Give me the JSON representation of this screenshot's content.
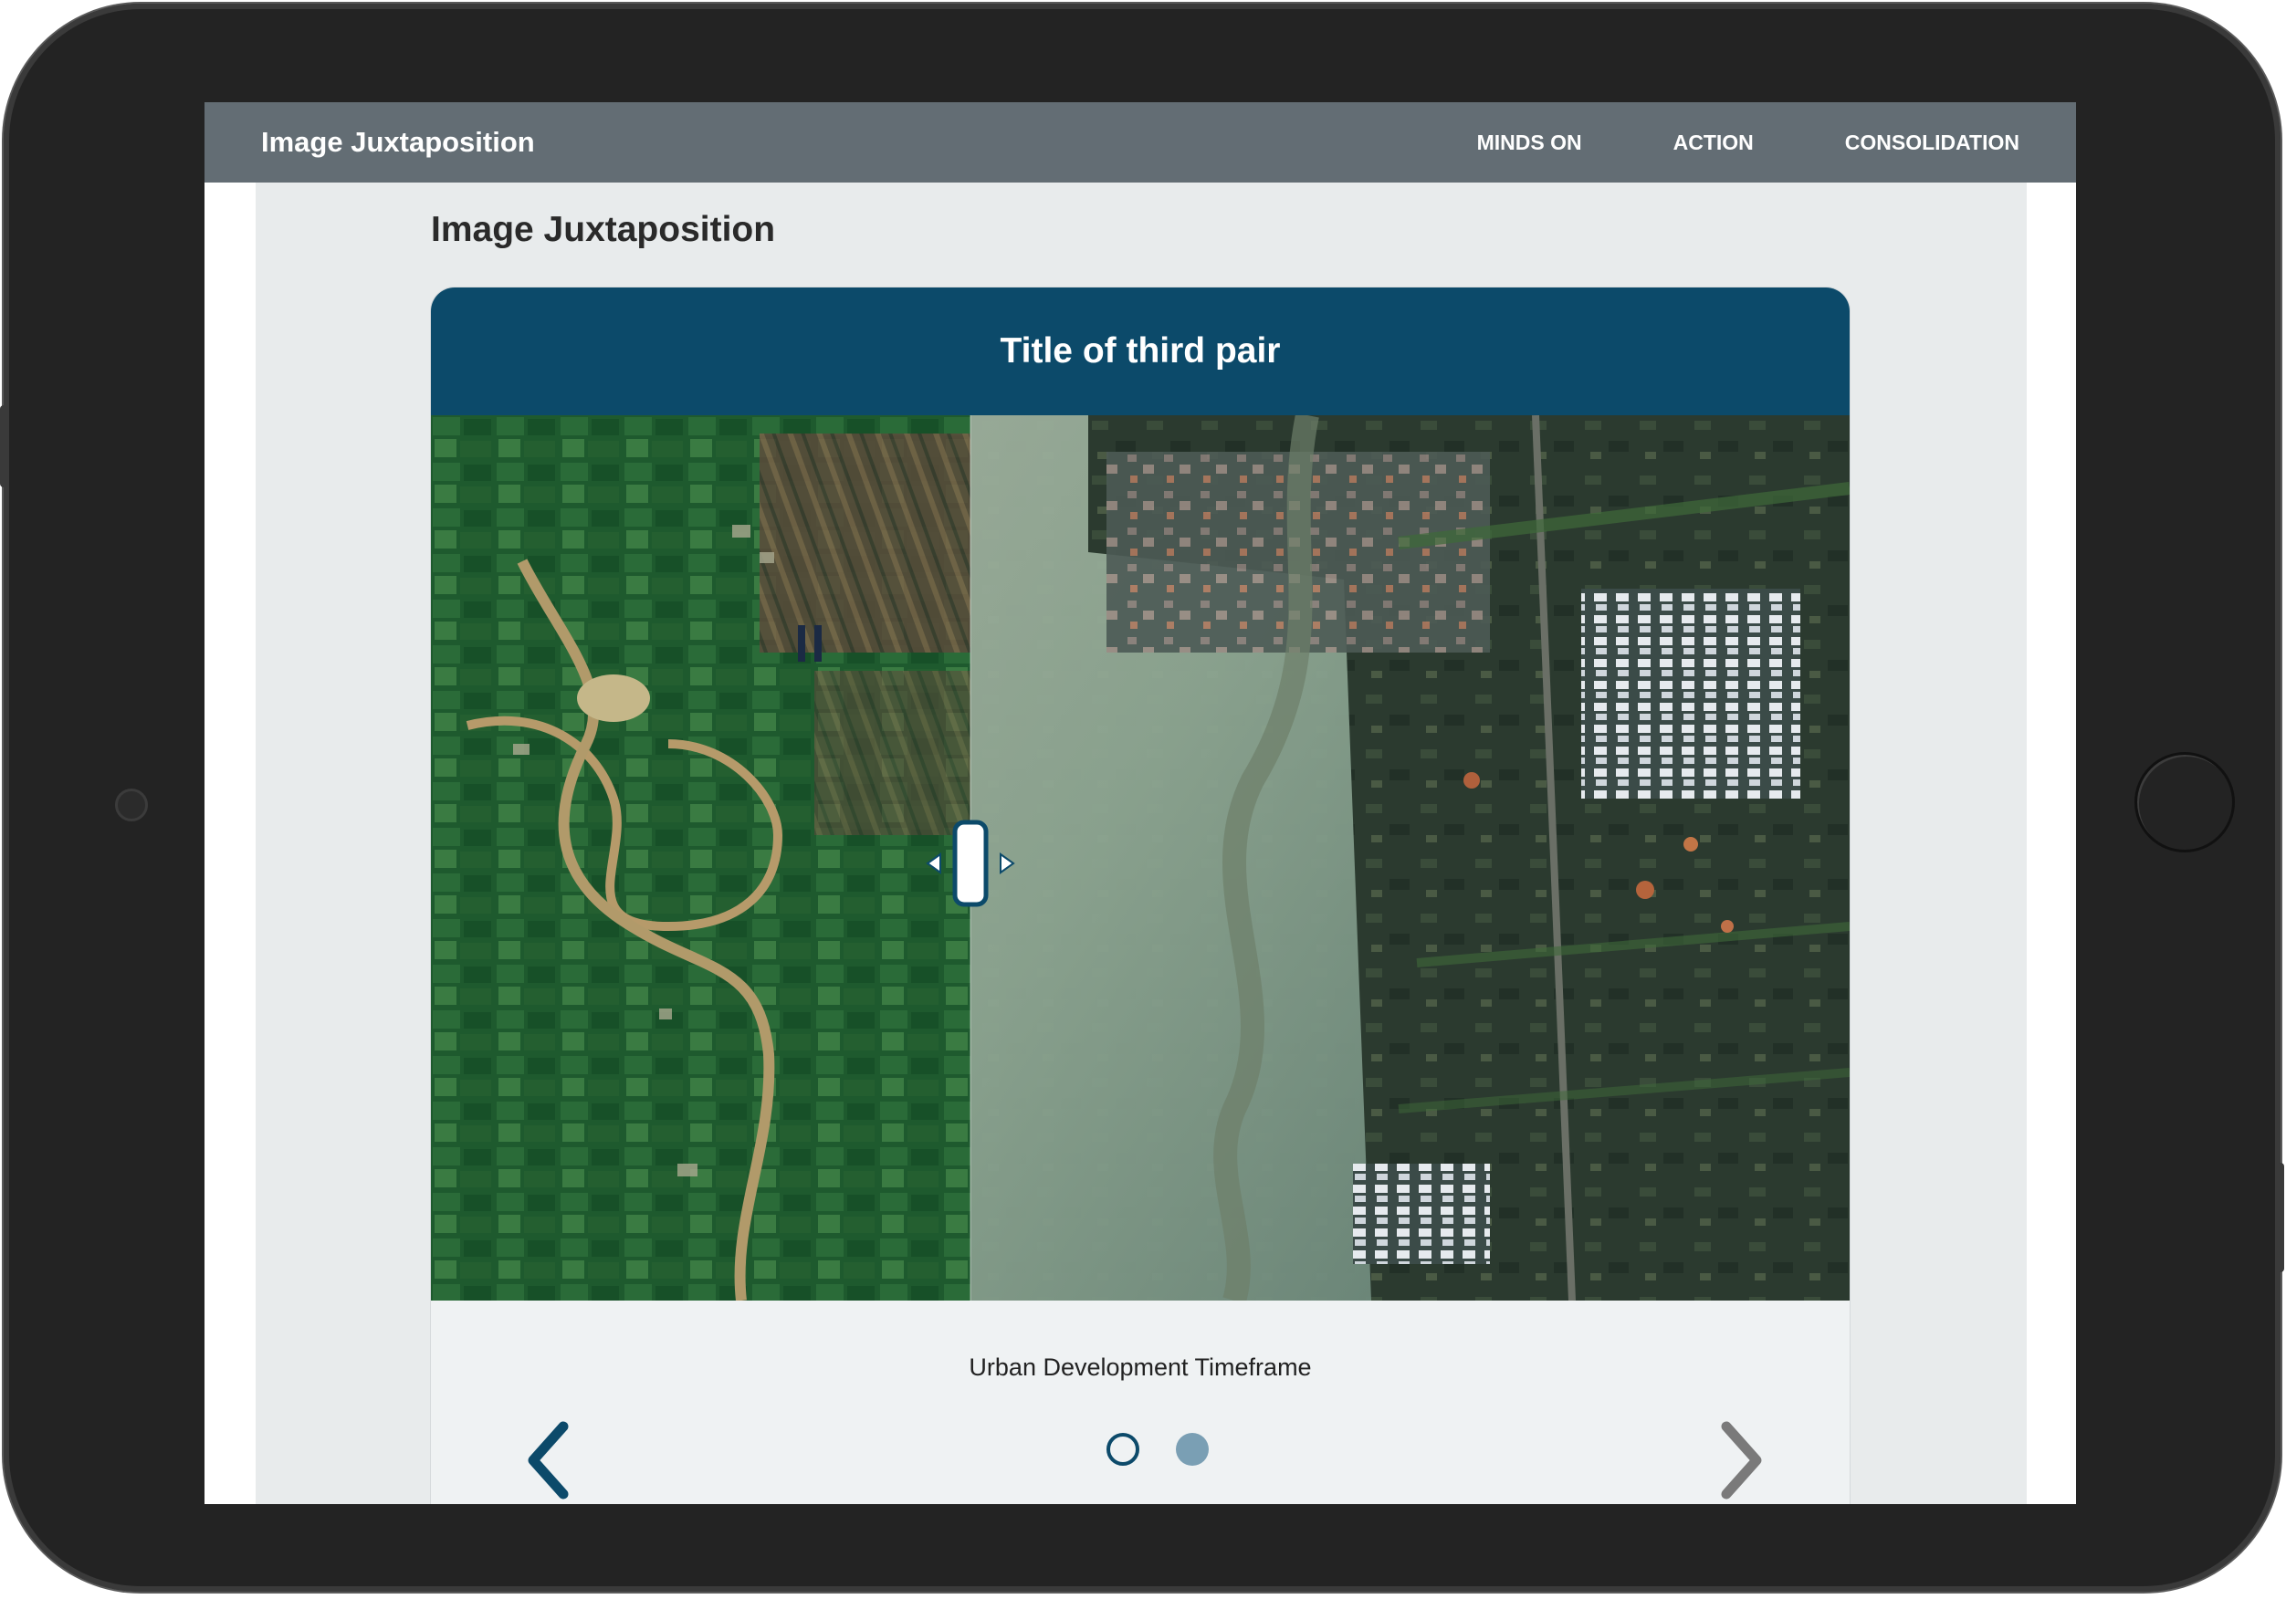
{
  "app": {
    "title": "Image Juxtaposition"
  },
  "nav": {
    "items": [
      {
        "label": "MINDS ON"
      },
      {
        "label": "ACTION"
      },
      {
        "label": "CONSOLIDATION"
      }
    ]
  },
  "page": {
    "title": "Image Juxtaposition"
  },
  "slider": {
    "pair_title": "Title of third pair",
    "caption": "Urban Development Timeframe",
    "divider_position_fraction": 0.38,
    "slide_count": 2,
    "active_slide": 2
  },
  "colors": {
    "topbar": "#636d74",
    "header": "#0c4a6a",
    "accent": "#0c4a6a",
    "dot_active": "#7a9fb4",
    "chevron_next": "#7a7a7a"
  },
  "icons": {
    "prev": "chevron-left-icon",
    "next": "chevron-right-icon",
    "handle": "drag-handle-icon"
  }
}
